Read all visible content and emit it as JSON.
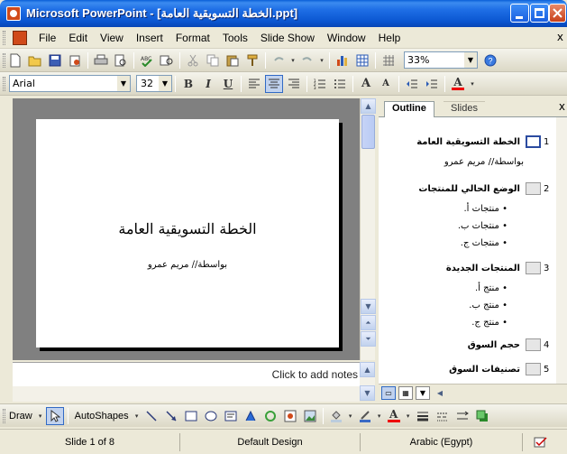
{
  "window": {
    "title": "Microsoft PowerPoint - [الخطة التسويقية العامة.ppt]"
  },
  "menu": {
    "items": [
      "File",
      "Edit",
      "View",
      "Insert",
      "Format",
      "Tools",
      "Slide Show",
      "Window",
      "Help"
    ],
    "close": "x"
  },
  "standard_toolbar": {
    "zoom": "33%"
  },
  "formatting_toolbar": {
    "font": "Arial",
    "size": "32",
    "bold": "B",
    "italic": "I",
    "underline": "U",
    "grow_font": "A",
    "shrink_font": "A",
    "font_color": "A"
  },
  "slide": {
    "title": "الخطة التسويقية العامة",
    "subtitle": "بواسطة// مريم عمرو"
  },
  "notes": {
    "placeholder": "Click to add notes"
  },
  "pane": {
    "tabs": [
      "Outline",
      "Slides"
    ],
    "close": "x",
    "slides": [
      {
        "num": "1",
        "title": "الخطة التسويقية العامة",
        "body": [
          "بواسطة// مريم عمرو"
        ]
      },
      {
        "num": "2",
        "title": "الوضع الحالي للمنتجات",
        "bullets": [
          "منتجات أ.",
          "منتجات ب.",
          "منتجات ج."
        ]
      },
      {
        "num": "3",
        "title": "المنتجات الجديدة",
        "bullets": [
          "منتج أ.",
          "منتج ب.",
          "منتج ج."
        ]
      },
      {
        "num": "4",
        "title": "حجم السوق"
      },
      {
        "num": "5",
        "title": "تصنيفات السوق"
      }
    ]
  },
  "drawing_toolbar": {
    "draw": "Draw",
    "autoshapes": "AutoShapes"
  },
  "status": {
    "slide": "Slide 1 of 8",
    "design": "Default Design",
    "language": "Arabic (Egypt)"
  },
  "colors": {
    "title_bar": "#0a55d0",
    "slide_background": "#808080",
    "close_button": "#c8401a"
  }
}
